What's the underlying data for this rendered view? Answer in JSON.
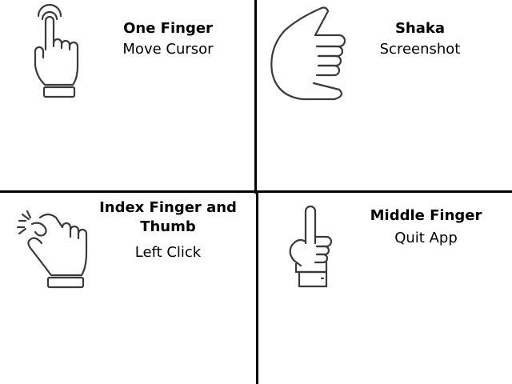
{
  "gestures": [
    {
      "name": "One Finger",
      "action": "Move Cursor",
      "icon": "pointing-finger-tap-icon"
    },
    {
      "name": "Shaka",
      "action": "Screenshot",
      "icon": "shaka-hand-icon"
    },
    {
      "name": "Index Finger and Thumb",
      "action": "Left Click",
      "icon": "pinch-hand-icon"
    },
    {
      "name": "Middle Finger",
      "action": "Quit App",
      "icon": "middle-finger-hand-icon"
    }
  ],
  "colors": {
    "line": "#000000",
    "icon_stroke": "#3a3a3a",
    "background": "#ffffff"
  }
}
